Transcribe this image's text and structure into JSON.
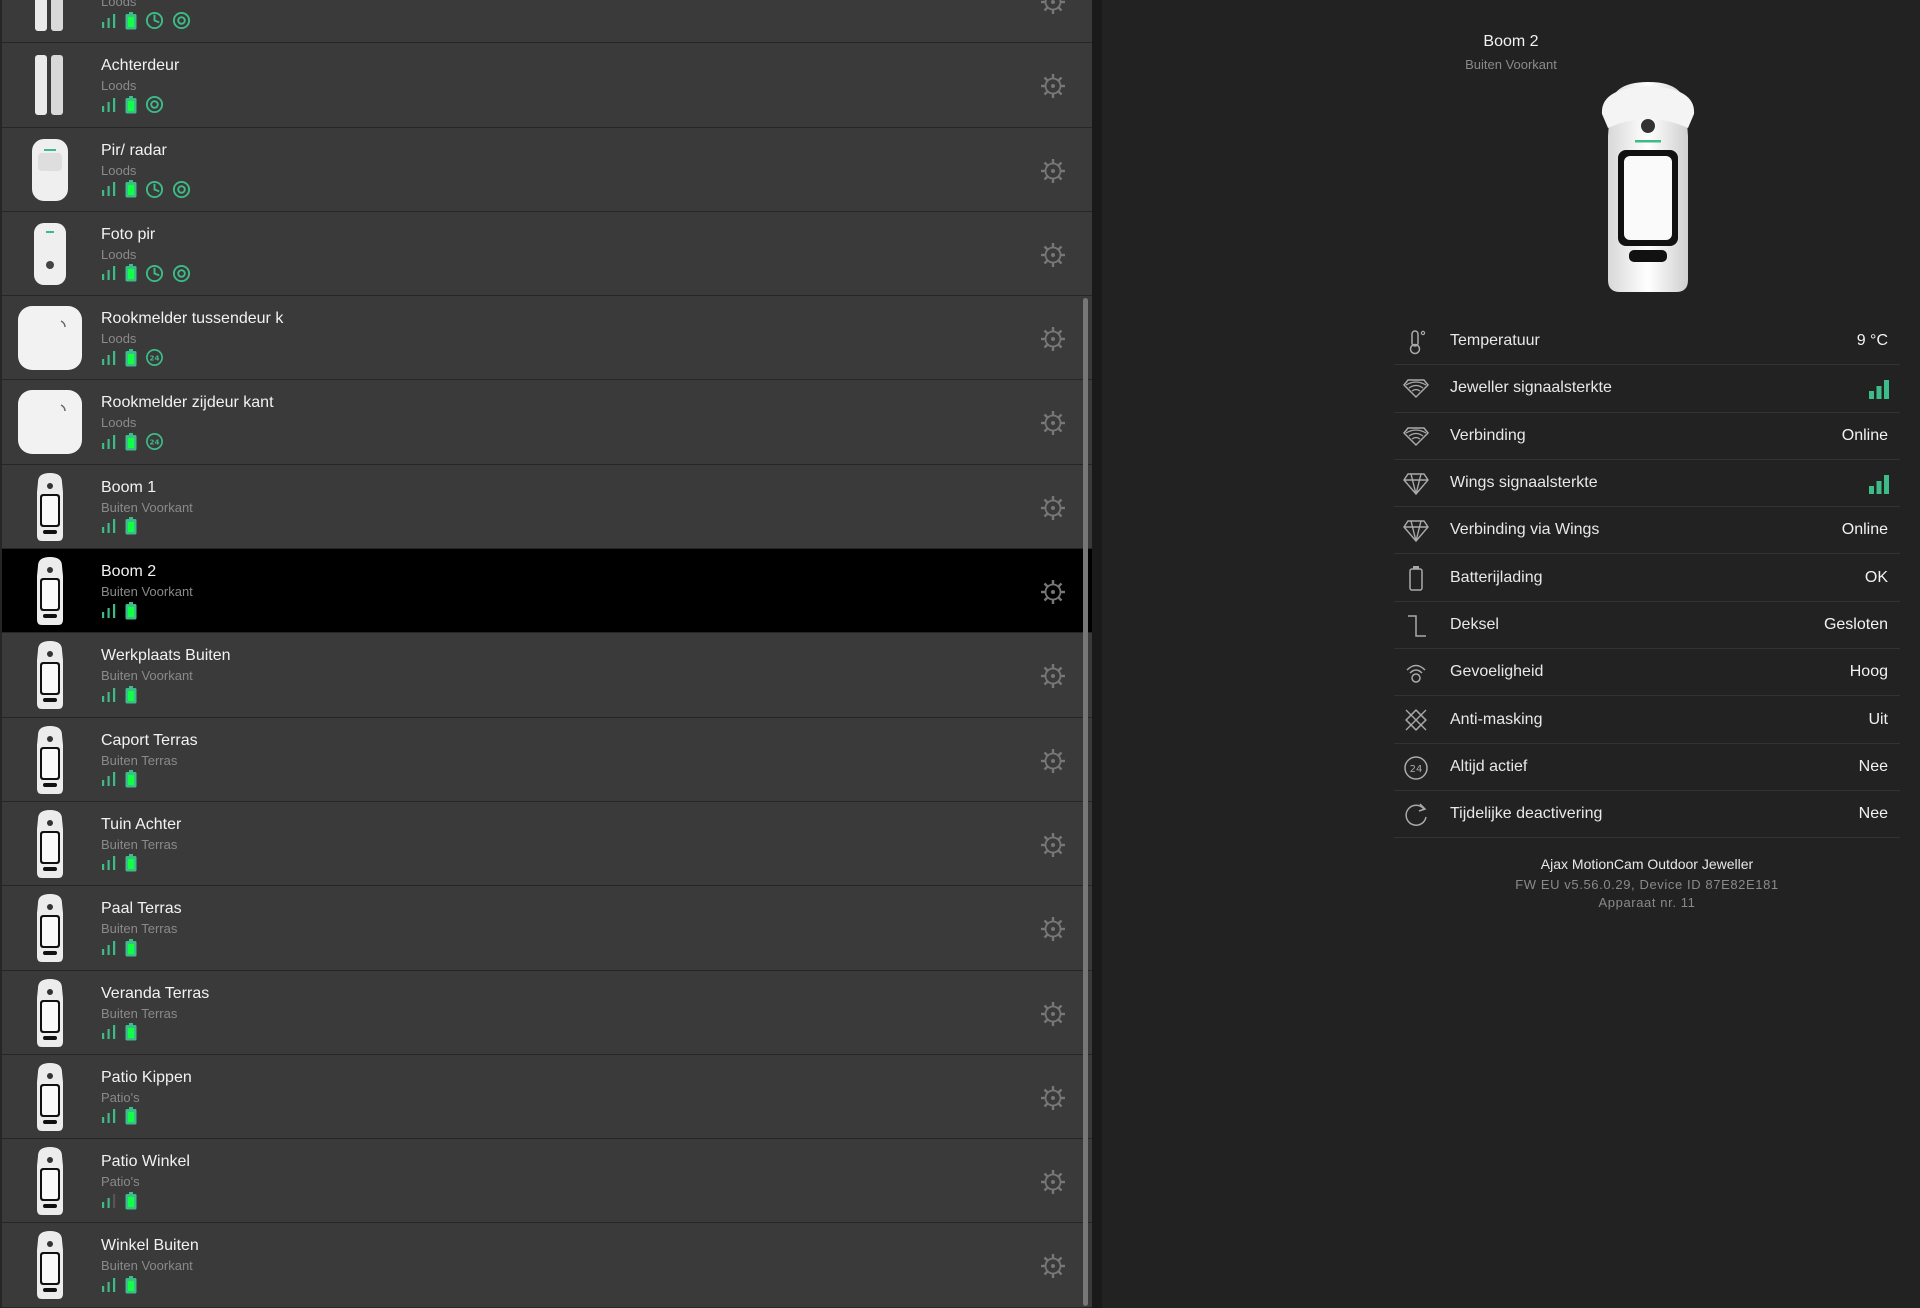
{
  "colors": {
    "accent": "#3dbb88",
    "background": "#222222",
    "row": "#3a3a3a",
    "selected_row": "#000000",
    "muted_text": "#8a8a8a"
  },
  "devices": [
    {
      "name": "",
      "room": "Loods",
      "type": "door",
      "icons": [
        "signal-icon",
        "battery-icon",
        "delay-icon",
        "sensitivity-icon"
      ],
      "selected": false
    },
    {
      "name": "Achterdeur",
      "room": "Loods",
      "type": "door",
      "icons": [
        "signal-icon",
        "battery-icon",
        "sensitivity-icon"
      ],
      "selected": false
    },
    {
      "name": "Pir/ radar",
      "room": "Loods",
      "type": "pir",
      "icons": [
        "signal-icon",
        "battery-icon",
        "delay-icon",
        "sensitivity-icon"
      ],
      "selected": false
    },
    {
      "name": "Foto pir",
      "room": "Loods",
      "type": "campir",
      "icons": [
        "signal-icon",
        "battery-icon",
        "delay-icon",
        "sensitivity-icon"
      ],
      "selected": false
    },
    {
      "name": "Rookmelder tussendeur k",
      "room": "Loods",
      "type": "smoke",
      "icons": [
        "signal-icon",
        "battery-icon",
        "always-active-icon"
      ],
      "selected": false
    },
    {
      "name": "Rookmelder zijdeur kant",
      "room": "Loods",
      "type": "smoke",
      "icons": [
        "signal-icon",
        "battery-icon",
        "always-active-icon"
      ],
      "selected": false
    },
    {
      "name": "Boom 1",
      "room": "Buiten Voorkant",
      "type": "outdoor",
      "icons": [
        "signal-icon",
        "battery-icon"
      ],
      "selected": false
    },
    {
      "name": "Boom 2",
      "room": "Buiten Voorkant",
      "type": "outdoor",
      "icons": [
        "signal-icon",
        "battery-icon"
      ],
      "selected": true
    },
    {
      "name": "Werkplaats Buiten",
      "room": "Buiten Voorkant",
      "type": "outdoor",
      "icons": [
        "signal-icon",
        "battery-icon"
      ],
      "selected": false
    },
    {
      "name": "Caport Terras",
      "room": "Buiten Terras",
      "type": "outdoor",
      "icons": [
        "signal-icon",
        "battery-icon"
      ],
      "selected": false
    },
    {
      "name": "Tuin Achter",
      "room": "Buiten Terras",
      "type": "outdoor",
      "icons": [
        "signal-icon",
        "battery-icon"
      ],
      "selected": false
    },
    {
      "name": "Paal Terras",
      "room": "Buiten Terras",
      "type": "outdoor",
      "icons": [
        "signal-icon",
        "battery-icon"
      ],
      "selected": false
    },
    {
      "name": "Veranda Terras",
      "room": "Buiten Terras",
      "type": "outdoor",
      "icons": [
        "signal-icon",
        "battery-icon"
      ],
      "selected": false
    },
    {
      "name": "Patio Kippen",
      "room": "Patio's",
      "type": "outdoor",
      "icons": [
        "signal-icon",
        "battery-icon"
      ],
      "selected": false
    },
    {
      "name": "Patio Winkel",
      "room": "Patio's",
      "type": "outdoor",
      "icons": [
        "signal-icon-weak",
        "battery-icon"
      ],
      "selected": false
    },
    {
      "name": "Winkel Buiten",
      "room": "Buiten Voorkant",
      "type": "outdoor",
      "icons": [
        "signal-icon",
        "battery-icon"
      ],
      "selected": false
    }
  ],
  "detail": {
    "title": "Boom 2",
    "room": "Buiten Voorkant",
    "properties": [
      {
        "icon": "thermometer-icon",
        "label": "Temperatuur",
        "value": "9 °C"
      },
      {
        "icon": "jeweller-icon",
        "label": "Jeweller signaalsterkte",
        "value": "",
        "signal_bars": 3
      },
      {
        "icon": "jeweller-icon",
        "label": "Verbinding",
        "value": "Online"
      },
      {
        "icon": "wings-icon",
        "label": "Wings signaalsterkte",
        "value": "",
        "signal_bars": 3
      },
      {
        "icon": "wings-icon",
        "label": "Verbinding via Wings",
        "value": "Online"
      },
      {
        "icon": "battery-outline-icon",
        "label": "Batterijlading",
        "value": "OK"
      },
      {
        "icon": "lid-icon",
        "label": "Deksel",
        "value": "Gesloten"
      },
      {
        "icon": "sensitivity-outline-icon",
        "label": "Gevoeligheid",
        "value": "Hoog"
      },
      {
        "icon": "anti-masking-icon",
        "label": "Anti-masking",
        "value": "Uit"
      },
      {
        "icon": "always-active-outline-icon",
        "label": "Altijd actief",
        "value": "Nee"
      },
      {
        "icon": "temp-deactivation-icon",
        "label": "Tijdelijke deactivering",
        "value": "Nee"
      }
    ],
    "model": "Ajax MotionCam Outdoor Jeweller",
    "firmware": "FW EU v5.56.0.29, Device ID 87E82E181",
    "device_number": "Apparaat nr. 11"
  }
}
